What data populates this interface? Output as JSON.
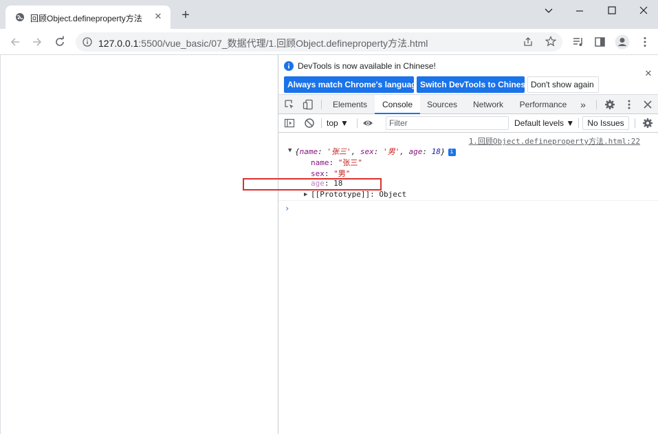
{
  "browser": {
    "tab_title": "回顾Object.defineproperty方法",
    "url_host": "127.0.0.1",
    "url_rest": ":5500/vue_basic/07_数据代理/1.回顾Object.defineproperty方法.html"
  },
  "devtools": {
    "infobar": {
      "message": "DevTools is now available in Chinese!",
      "btn_match": "Always match Chrome's language",
      "btn_switch": "Switch DevTools to Chinese",
      "btn_dont_show": "Don't show again"
    },
    "tabs": [
      "Elements",
      "Console",
      "Sources",
      "Network",
      "Performance"
    ],
    "active_tab": "Console",
    "console_toolbar": {
      "context": "top",
      "filter_placeholder": "Filter",
      "levels": "Default levels",
      "issues": "No Issues"
    },
    "console": {
      "source_link": "1.回顾Object.defineproperty方法.html:22",
      "summary": {
        "open": "{",
        "name_key": "name",
        "name_val": "'张三'",
        "sex_key": "sex",
        "sex_val": "'男'",
        "age_key": "age",
        "age_val": "18",
        "close": "}"
      },
      "props": [
        {
          "key": "name",
          "value": "\"张三\""
        },
        {
          "key": "sex",
          "value": "\"男\""
        },
        {
          "key": "age",
          "value": "18"
        }
      ],
      "prototype_key": "[[Prototype]]",
      "prototype_val": "Object",
      "prompt": "›"
    }
  },
  "colors": {
    "accent": "#1a73e8",
    "highlight": "#d9302c",
    "property_key": "#881280",
    "string_value": "#c41a16",
    "number_value": "#1a1aa6"
  }
}
